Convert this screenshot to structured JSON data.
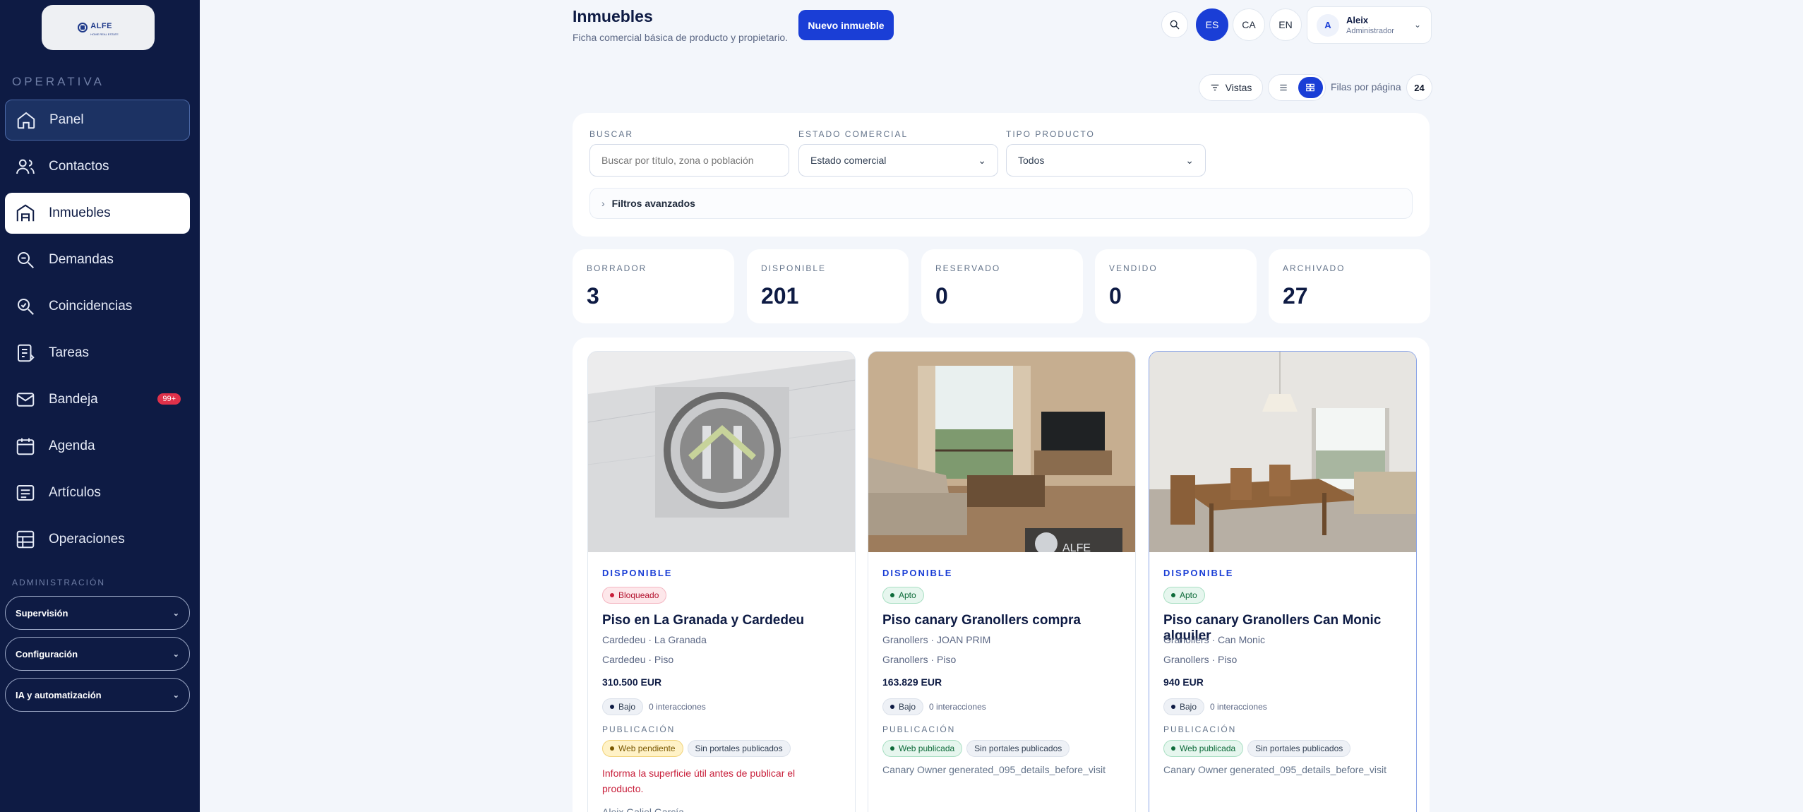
{
  "brand": {
    "logo_text": "ALFE",
    "logo_sub": "HOME REAL ESTATE"
  },
  "sidebar": {
    "section_operativa": "OPERATIVA",
    "items": [
      {
        "label": "Panel",
        "icon": "home-icon"
      },
      {
        "label": "Contactos",
        "icon": "users-icon"
      },
      {
        "label": "Inmuebles",
        "icon": "building-icon"
      },
      {
        "label": "Demandas",
        "icon": "search-icon"
      },
      {
        "label": "Coincidencias",
        "icon": "search-match-icon"
      },
      {
        "label": "Tareas",
        "icon": "clipboard-icon"
      },
      {
        "label": "Bandeja",
        "icon": "mail-icon",
        "badge": "99+"
      },
      {
        "label": "Agenda",
        "icon": "calendar-icon"
      },
      {
        "label": "Artículos",
        "icon": "article-icon"
      },
      {
        "label": "Operaciones",
        "icon": "operations-icon"
      }
    ],
    "section_admin": "ADMINISTRACIÓN",
    "groups": [
      "Supervisión",
      "Configuración",
      "IA y automatización"
    ]
  },
  "header": {
    "title": "Inmuebles",
    "subtitle": "Ficha comercial básica de producto y propietario.",
    "new_button": "Nuevo inmueble",
    "languages": [
      "ES",
      "CA",
      "EN"
    ],
    "active_language": "ES",
    "user": {
      "initial": "A",
      "name": "Aleix",
      "role": "Administrador"
    }
  },
  "toolbar": {
    "views_label": "Vistas",
    "rows_label": "Filas por página",
    "rows_value": "24"
  },
  "filters": {
    "search_label": "BUSCAR",
    "search_placeholder": "Buscar por título, zona o población",
    "estado_label": "ESTADO COMERCIAL",
    "estado_value": "Estado comercial",
    "tipo_label": "TIPO PRODUCTO",
    "tipo_value": "Todos",
    "advanced": "Filtros avanzados"
  },
  "stats": [
    {
      "label": "BORRADOR",
      "value": "3"
    },
    {
      "label": "DISPONIBLE",
      "value": "201"
    },
    {
      "label": "RESERVADO",
      "value": "0"
    },
    {
      "label": "VENDIDO",
      "value": "0"
    },
    {
      "label": "ARCHIVADO",
      "value": "27"
    }
  ],
  "cards": [
    {
      "status": "DISPONIBLE",
      "tag": "Bloqueado",
      "title": "Piso en La Granada y Cardedeu",
      "location": "Cardedeu · La Granada",
      "type": "Cardedeu · Piso",
      "price": "310.500 EUR",
      "level": "Bajo",
      "interactions": "0 interacciones",
      "pub_label": "PUBLICACIÓN",
      "web": "Web pendiente",
      "portals": "Sin portales publicados",
      "warning": "Informa la superficie útil antes de publicar el producto.",
      "note": "Aleix Galiel García"
    },
    {
      "status": "DISPONIBLE",
      "tag": "Apto",
      "title": "Piso canary Granollers compra",
      "location": "Granollers · JOAN PRIM",
      "type": "Granollers · Piso",
      "price": "163.829 EUR",
      "level": "Bajo",
      "interactions": "0 interacciones",
      "pub_label": "PUBLICACIÓN",
      "web": "Web publicada",
      "portals": "Sin portales publicados",
      "note": "Canary Owner generated_095_details_before_visit"
    },
    {
      "status": "DISPONIBLE",
      "tag": "Apto",
      "title": "Piso canary Granollers Can Monic alquiler",
      "location": "Granollers · Can Monic",
      "type": "Granollers · Piso",
      "price": "940 EUR",
      "level": "Bajo",
      "interactions": "0 interacciones",
      "pub_label": "PUBLICACIÓN",
      "web": "Web publicada",
      "portals": "Sin portales publicados",
      "note": "Canary Owner generated_095_details_before_visit"
    }
  ],
  "colors": {
    "sidebar": "#0e1b44",
    "accent": "#1a3ed6",
    "danger": "#c81e3a"
  }
}
